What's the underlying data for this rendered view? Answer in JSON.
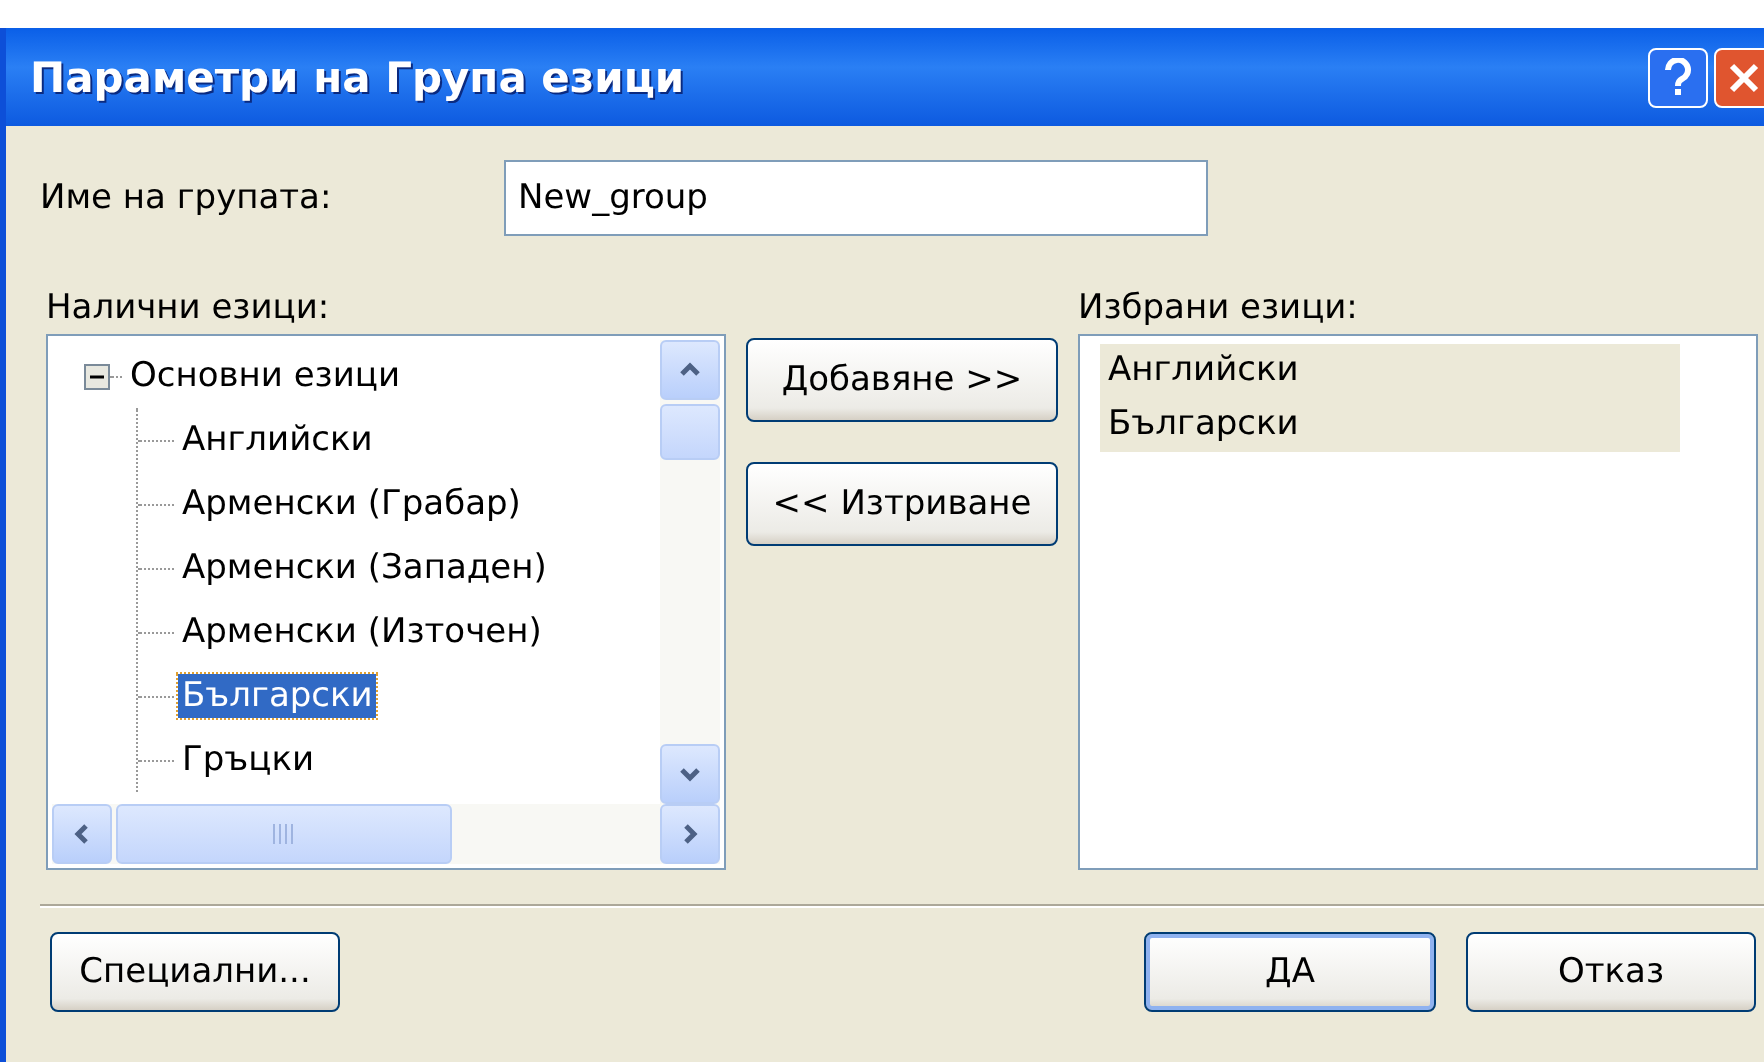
{
  "window": {
    "title": "Параметри на Група езици"
  },
  "name_field": {
    "label": "Име на групата:",
    "value": "New_group"
  },
  "available": {
    "label": "Налични езици:",
    "tree": [
      {
        "label": "Основни езици",
        "expanded": true,
        "selected": false,
        "children": [
          {
            "label": "Английски",
            "selected": false
          },
          {
            "label": "Арменски (Грабар)",
            "selected": false
          },
          {
            "label": "Арменски (Западен)",
            "selected": false
          },
          {
            "label": "Арменски (Източен)",
            "selected": false
          },
          {
            "label": "Български",
            "selected": true
          },
          {
            "label": "Гръцки",
            "selected": false
          }
        ]
      }
    ]
  },
  "move_buttons": [
    {
      "label": "Добавяне >>"
    },
    {
      "label": "<< Изтриване"
    }
  ],
  "selected_languages": {
    "label": "Избрани езици:",
    "items": [
      {
        "label": "Английски",
        "selected": true
      },
      {
        "label": "Български",
        "selected": true
      }
    ]
  },
  "footer_buttons": [
    {
      "label": "Специални...",
      "default": false
    },
    {
      "label": "ДА",
      "default": true
    },
    {
      "label": "Отказ",
      "default": false
    }
  ]
}
